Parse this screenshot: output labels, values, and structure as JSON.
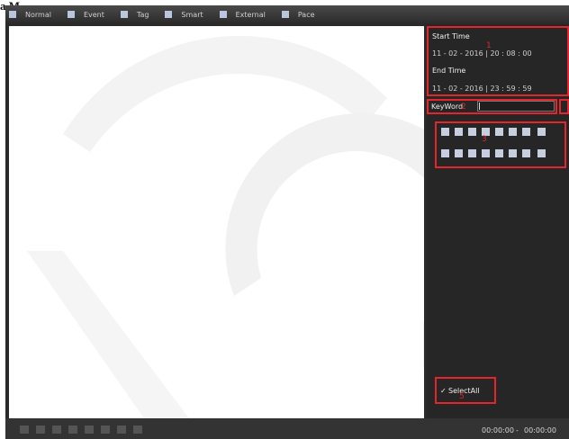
{
  "corner_label": "a.M",
  "tabs": [
    "Normal",
    "Event",
    "Tag",
    "Smart",
    "External",
    "Pace"
  ],
  "start_time": {
    "label": "Start Time",
    "value": "11 - 02 - 2016 | 20 : 08 : 00"
  },
  "end_time": {
    "label": "End Time",
    "value": "11 - 02 - 2016 | 23 : 59 : 59"
  },
  "keyword": {
    "label": "KeyWord",
    "value": ""
  },
  "markers": {
    "start": "1",
    "keyword": "2",
    "channels": "3",
    "select_all": "5"
  },
  "select_all": {
    "check": "✓",
    "label": "SelectAll"
  },
  "playback": {
    "start": "00:00:00",
    "separator": "-",
    "end": "00:00:00"
  },
  "colors": {
    "highlight": "#e2262c",
    "panel": "#262626",
    "tab_icon": "#b9c6dc"
  }
}
